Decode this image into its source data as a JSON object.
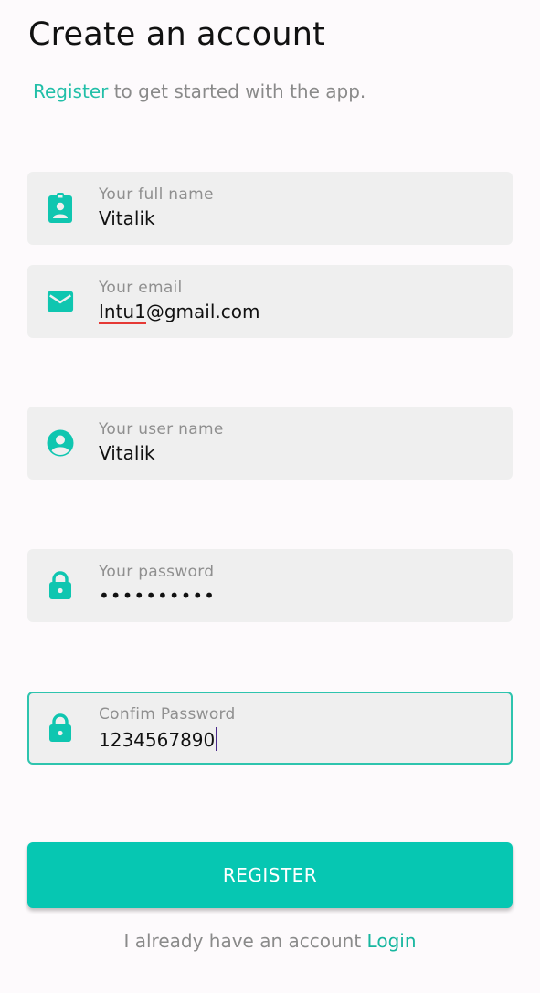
{
  "header": {
    "title": "Create an account",
    "subtitle_link": "Register",
    "subtitle_rest": " to get started with the app."
  },
  "fields": {
    "full_name": {
      "label": "Your full name",
      "value": "Vitalik",
      "icon": "badge-icon"
    },
    "email": {
      "label": "Your email",
      "value_misspelled": "Intu1",
      "value_rest": "@gmail.com",
      "icon": "mail-icon"
    },
    "user_name": {
      "label": "Your user name",
      "value": "Vitalik",
      "icon": "account-circle-icon"
    },
    "password": {
      "label": "Your password",
      "value": "••••••••••",
      "icon": "lock-icon"
    },
    "confirm_password": {
      "label": "Confim Password",
      "value": "1234567890",
      "icon": "lock-icon"
    }
  },
  "actions": {
    "register_label": "REGISTER",
    "footer_text": "I already have an account ",
    "login_label": "Login"
  },
  "colors": {
    "accent": "#06c7b2",
    "icon": "#0fc6b0",
    "background": "#fdfafc",
    "field_bg": "#efefef"
  }
}
